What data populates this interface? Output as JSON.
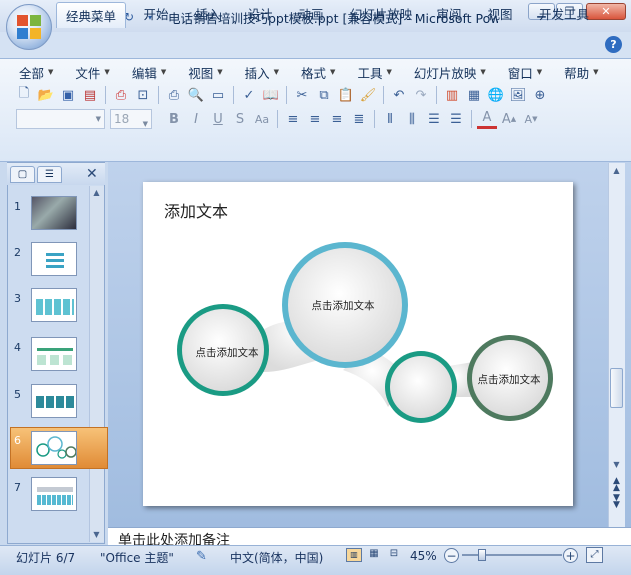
{
  "window": {
    "title": "电话销售培训技巧ppt模板.ppt [兼容模式] - Microsoft PowerPoint",
    "minimize_icon": "minimize-icon",
    "maximize_icon": "maximize-icon",
    "close_icon": "close-icon"
  },
  "ribbon_tabs": [
    "经典菜单",
    "开始",
    "插入",
    "设计",
    "动画",
    "幻灯片放映",
    "审阅",
    "视图",
    "开发工具"
  ],
  "menubar": [
    "全部",
    "文件",
    "编辑",
    "视图",
    "插入",
    "格式",
    "工具",
    "幻灯片放映",
    "窗口",
    "帮助"
  ],
  "font": {
    "name": "",
    "size": "18"
  },
  "slides": [
    {
      "num": "1"
    },
    {
      "num": "2"
    },
    {
      "num": "3"
    },
    {
      "num": "4"
    },
    {
      "num": "5"
    },
    {
      "num": "6"
    },
    {
      "num": "7"
    }
  ],
  "selected_slide": 6,
  "slide": {
    "title": "添加文本",
    "circles": [
      "点击添加文本",
      "点击添加文本",
      "点击添加文本"
    ]
  },
  "notes": {
    "placeholder": "单击此处添加备注"
  },
  "status": {
    "slide_info": "幻灯片 6/7",
    "theme": "\"Office 主题\"",
    "language": "中文(简体，中国)",
    "zoom": "45%",
    "zoom_percent": 45
  },
  "colors": {
    "accent_teal": "#1a9b84",
    "accent_blue": "#5bb6cf",
    "accent_green": "#4e7a5f",
    "selection": "#e9973f"
  }
}
